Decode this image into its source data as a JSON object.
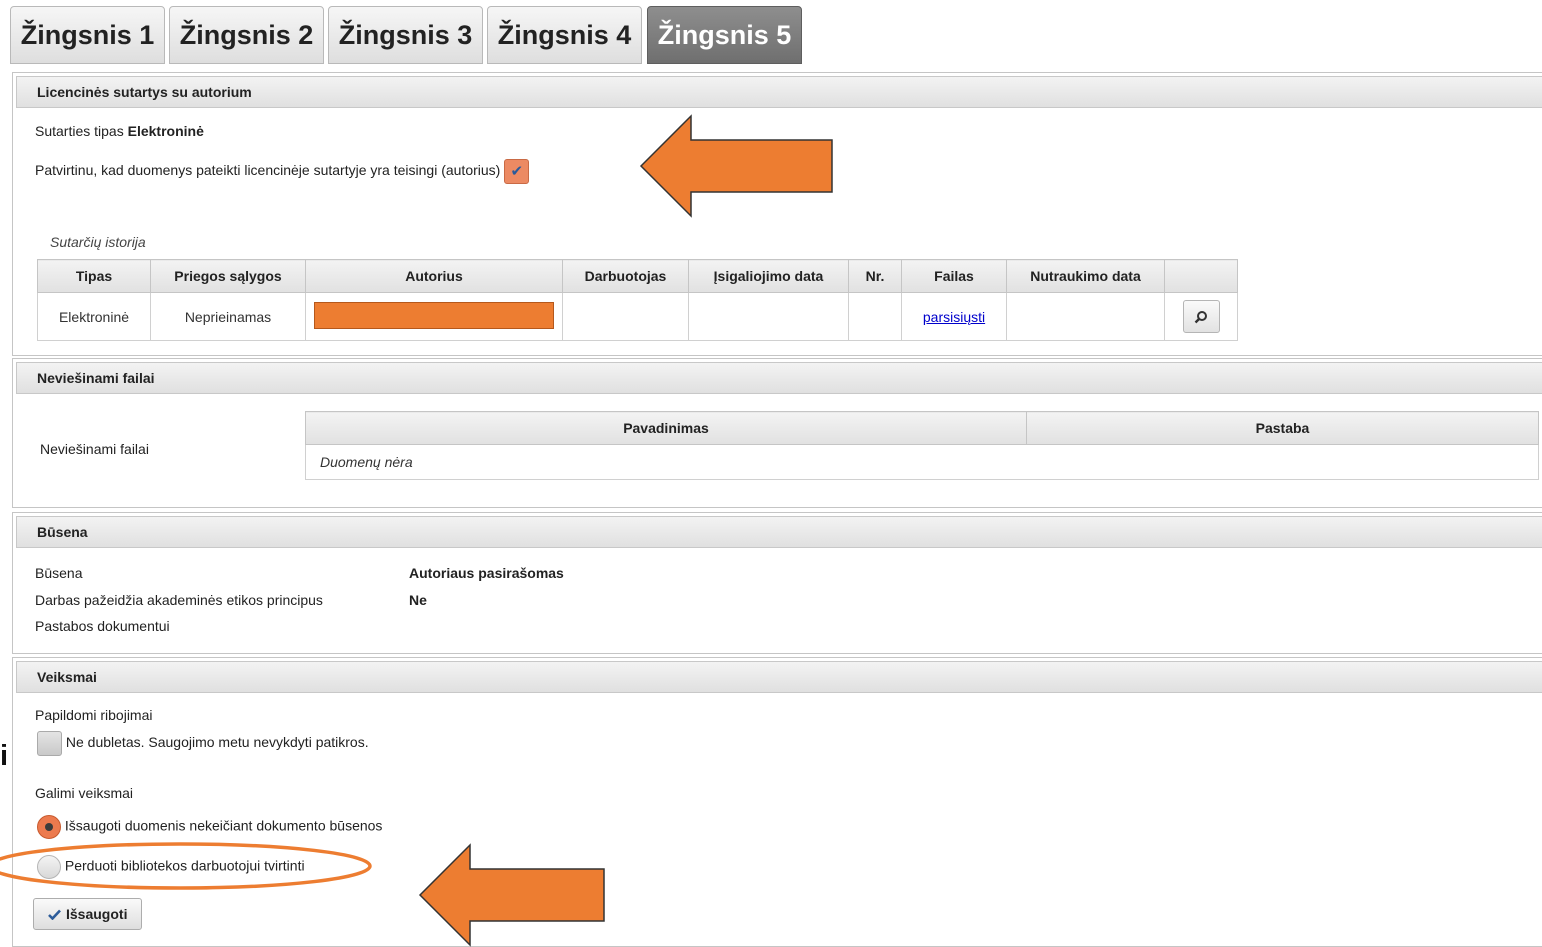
{
  "tabs": [
    {
      "label": "Žingsnis 1",
      "active": false
    },
    {
      "label": "Žingsnis 2",
      "active": false
    },
    {
      "label": "Žingsnis 3",
      "active": false
    },
    {
      "label": "Žingsnis 4",
      "active": false
    },
    {
      "label": "Žingsnis 5",
      "active": true
    }
  ],
  "license": {
    "header": "Licencinės sutartys su autorium",
    "type_label": "Sutarties tipas",
    "type_value": "Elektroninė",
    "confirm_text": "Patvirtinu, kad duomenys pateikti licencinėje sutartyje yra teisingi (autorius)",
    "confirm_checked": true,
    "history_caption": "Sutarčių istorija",
    "columns": [
      "Tipas",
      "Priegos sąlygos",
      "Autorius",
      "Darbuotojas",
      "Įsigaliojimo data",
      "Nr.",
      "Failas",
      "Nutraukimo data",
      ""
    ],
    "row": {
      "tipas": "Elektroninė",
      "priegos": "Neprieinamas",
      "autorius_redacted": true,
      "darbuotojas": "",
      "isigaliojimo": "",
      "nr": "",
      "failas": "parsisiųsti",
      "nutraukimo": ""
    },
    "view_icon": "magnifier-icon"
  },
  "hidden_files": {
    "header": "Neviešinami failai",
    "label": "Neviešinami failai",
    "columns": [
      "Pavadinimas",
      "Pastaba"
    ],
    "empty_text": "Duomenų nėra"
  },
  "status": {
    "header": "Būsena",
    "rows": [
      {
        "label": "Būsena",
        "value": "Autoriaus pasirašomas"
      },
      {
        "label": "Darbas pažeidžia akademinės etikos principus",
        "value": "Ne"
      },
      {
        "label": "Pastabos dokumentui",
        "value": ""
      }
    ]
  },
  "actions": {
    "header": "Veiksmai",
    "restrictions_label": "Papildomi ribojimai",
    "no_duplicate_text": "Ne dubletas. Saugojimo metu nevykdyti patikros.",
    "no_duplicate_checked": false,
    "possible_label": "Galimi veiksmai",
    "options": [
      {
        "label": "Išsaugoti duomenis nekeičiant dokumento būsenos",
        "selected": true
      },
      {
        "label": "Perduoti bibliotekos darbuotojui tvirtinti",
        "selected": false
      }
    ],
    "save_label": "Išsaugoti"
  },
  "annotations": {
    "arrow_color": "#ed7d31",
    "edge_glyph": "i"
  }
}
